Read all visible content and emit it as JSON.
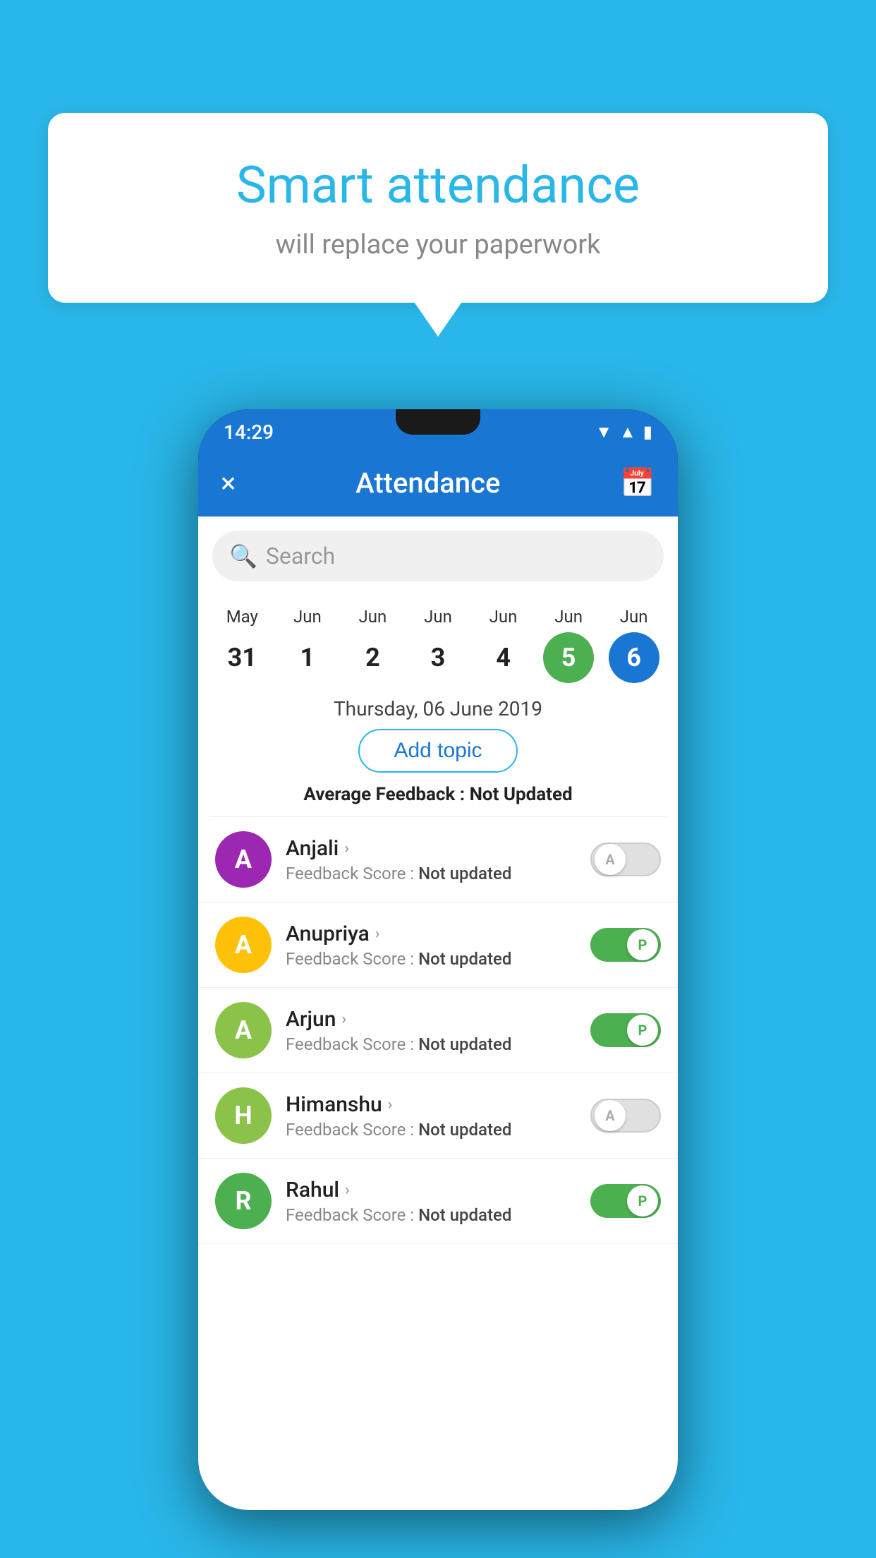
{
  "background_color": "#29b6e8",
  "bubble": {
    "title": "Smart attendance",
    "subtitle": "will replace your paperwork"
  },
  "phone": {
    "status_bar": {
      "time": "14:29"
    },
    "app_bar": {
      "title": "Attendance",
      "close_label": "×",
      "calendar_label": "📅"
    },
    "search": {
      "placeholder": "Search"
    },
    "calendar": {
      "days": [
        {
          "month": "May",
          "date": "31",
          "state": "normal"
        },
        {
          "month": "Jun",
          "date": "1",
          "state": "normal"
        },
        {
          "month": "Jun",
          "date": "2",
          "state": "normal"
        },
        {
          "month": "Jun",
          "date": "3",
          "state": "normal"
        },
        {
          "month": "Jun",
          "date": "4",
          "state": "normal"
        },
        {
          "month": "Jun",
          "date": "5",
          "state": "today"
        },
        {
          "month": "Jun",
          "date": "6",
          "state": "selected"
        }
      ]
    },
    "selected_date": "Thursday, 06 June 2019",
    "add_topic": "Add topic",
    "avg_feedback_label": "Average Feedback : ",
    "avg_feedback_value": "Not Updated",
    "students": [
      {
        "name": "Anjali",
        "avatar_letter": "A",
        "avatar_color": "#9c27b0",
        "feedback": "Not updated",
        "toggle": "off",
        "toggle_letter": "A"
      },
      {
        "name": "Anupriya",
        "avatar_letter": "A",
        "avatar_color": "#ffc107",
        "feedback": "Not updated",
        "toggle": "on",
        "toggle_letter": "P"
      },
      {
        "name": "Arjun",
        "avatar_letter": "A",
        "avatar_color": "#8bc34a",
        "feedback": "Not updated",
        "toggle": "on",
        "toggle_letter": "P"
      },
      {
        "name": "Himanshu",
        "avatar_letter": "H",
        "avatar_color": "#8bc34a",
        "feedback": "Not updated",
        "toggle": "off",
        "toggle_letter": "A"
      },
      {
        "name": "Rahul",
        "avatar_letter": "R",
        "avatar_color": "#4caf50",
        "feedback": "Not updated",
        "toggle": "on",
        "toggle_letter": "P"
      }
    ],
    "feedback_score_label": "Feedback Score : "
  }
}
